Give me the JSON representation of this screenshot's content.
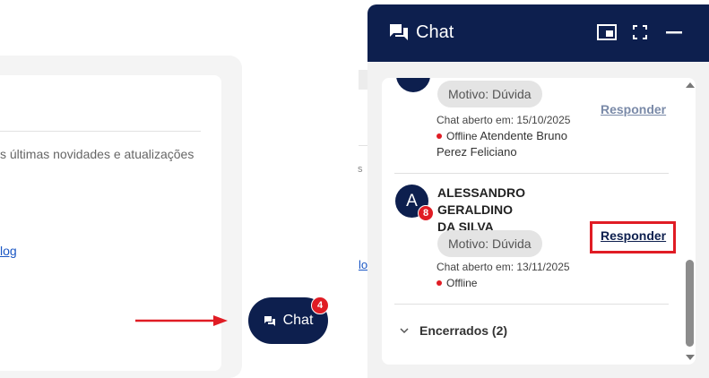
{
  "background": {
    "text_line": "s últimas novidades e atualizações",
    "link_text": "log",
    "fragment_1": "s",
    "fragment_2": "lo"
  },
  "chat_button": {
    "label": "Chat",
    "badge": "4"
  },
  "chat_window": {
    "title": "Chat",
    "header_buttons": [
      "picture-in-picture-icon",
      "fullscreen-icon",
      "minimize-icon"
    ],
    "conversations": [
      {
        "reason": "Motivo: Dúvida",
        "opened": "Chat aberto em: 15/10/2025",
        "status": "Offline",
        "agent": "Atendente Bruno Perez Feliciano",
        "agent_line1": "Atendente Bruno",
        "agent_line2": "Perez Feliciano",
        "action": "Responder"
      },
      {
        "avatar_letter": "A",
        "unread": "8",
        "name": "ALESSANDRO GERALDINO DA SILVA",
        "name_line1": "ALESSANDRO GERALDINO",
        "name_line2": "DA SILVA",
        "reason": "Motivo: Dúvida",
        "opened": "Chat aberto em: 13/11/2025",
        "status": "Offline",
        "action": "Responder"
      }
    ],
    "closed_section": "Encerrados (2)"
  },
  "colors": {
    "navy": "#0d1f4e",
    "red": "#e01c24",
    "link_muted": "#7a8aa8"
  }
}
